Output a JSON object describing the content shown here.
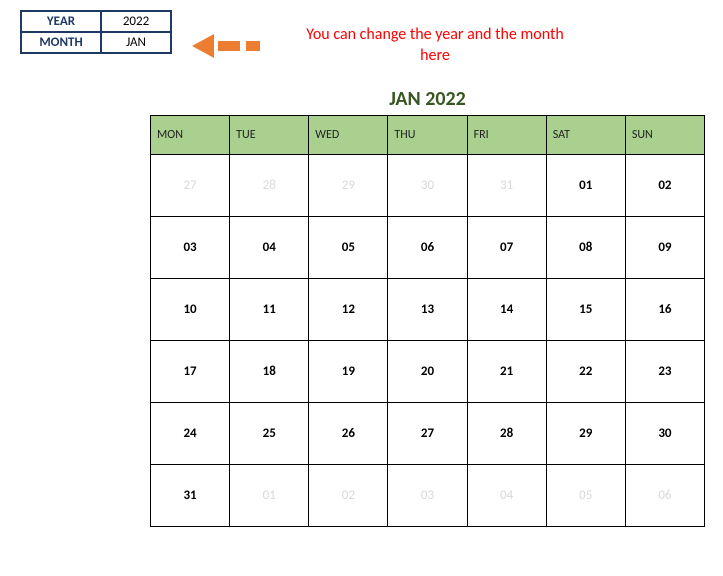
{
  "inputs": {
    "year_label": "YEAR",
    "year_value": "2022",
    "month_label": "MONTH",
    "month_value": "JAN"
  },
  "hint": "You can change the year and the month here",
  "calendar": {
    "title": "JAN 2022",
    "headers": [
      "MON",
      "TUE",
      "WED",
      "THU",
      "FRI",
      "SAT",
      "SUN"
    ],
    "weeks": [
      [
        {
          "d": "27",
          "dim": true
        },
        {
          "d": "28",
          "dim": true
        },
        {
          "d": "29",
          "dim": true
        },
        {
          "d": "30",
          "dim": true
        },
        {
          "d": "31",
          "dim": true
        },
        {
          "d": "01",
          "dim": false
        },
        {
          "d": "02",
          "dim": false
        }
      ],
      [
        {
          "d": "03",
          "dim": false
        },
        {
          "d": "04",
          "dim": false
        },
        {
          "d": "05",
          "dim": false
        },
        {
          "d": "06",
          "dim": false
        },
        {
          "d": "07",
          "dim": false
        },
        {
          "d": "08",
          "dim": false
        },
        {
          "d": "09",
          "dim": false
        }
      ],
      [
        {
          "d": "10",
          "dim": false
        },
        {
          "d": "11",
          "dim": false
        },
        {
          "d": "12",
          "dim": false
        },
        {
          "d": "13",
          "dim": false
        },
        {
          "d": "14",
          "dim": false
        },
        {
          "d": "15",
          "dim": false
        },
        {
          "d": "16",
          "dim": false
        }
      ],
      [
        {
          "d": "17",
          "dim": false
        },
        {
          "d": "18",
          "dim": false
        },
        {
          "d": "19",
          "dim": false
        },
        {
          "d": "20",
          "dim": false
        },
        {
          "d": "21",
          "dim": false
        },
        {
          "d": "22",
          "dim": false
        },
        {
          "d": "23",
          "dim": false
        }
      ],
      [
        {
          "d": "24",
          "dim": false
        },
        {
          "d": "25",
          "dim": false
        },
        {
          "d": "26",
          "dim": false
        },
        {
          "d": "27",
          "dim": false
        },
        {
          "d": "28",
          "dim": false
        },
        {
          "d": "29",
          "dim": false
        },
        {
          "d": "30",
          "dim": false
        }
      ],
      [
        {
          "d": "31",
          "dim": false
        },
        {
          "d": "01",
          "dim": true
        },
        {
          "d": "02",
          "dim": true
        },
        {
          "d": "03",
          "dim": true
        },
        {
          "d": "04",
          "dim": true
        },
        {
          "d": "05",
          "dim": true
        },
        {
          "d": "06",
          "dim": true
        }
      ]
    ]
  }
}
